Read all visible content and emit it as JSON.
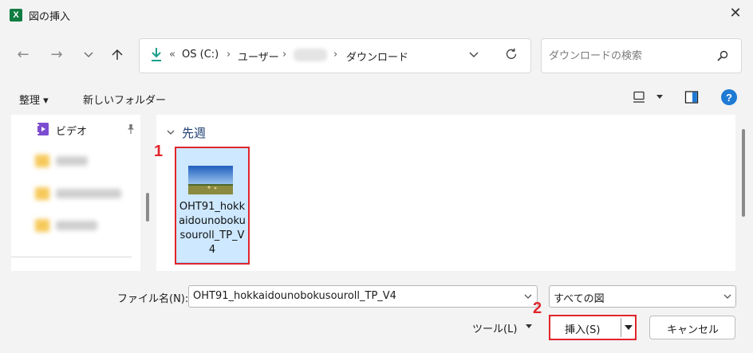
{
  "window": {
    "title": "図の挿入",
    "app_icon_text": "X"
  },
  "address_bar": {
    "overflow_marker": "«",
    "crumbs": [
      "OS (C:)",
      "ユーザー",
      "ダウンロード"
    ]
  },
  "search": {
    "placeholder": "ダウンロードの検索"
  },
  "command_bar": {
    "organize_label": "整理 ▾",
    "new_folder_label": "新しいフォルダー"
  },
  "nav_pane": {
    "video_label": "ビデオ"
  },
  "file_list": {
    "group_label": "先週",
    "files": [
      {
        "name": "OHT91_hokkaidounobokusouroll_TP_V4"
      }
    ]
  },
  "annotations": {
    "step1": "1",
    "step2": "2",
    "color": "#e0262b"
  },
  "bottom": {
    "filename_label": "ファイル名(N):",
    "filename_value": "OHT91_hokkaidounobokusouroll_TP_V4",
    "filetype_value": "すべての図",
    "tools_label": "ツール(L)",
    "insert_label": "挿入(S)",
    "cancel_label": "キャンセル"
  },
  "colors": {
    "accent": "#1f7ad3",
    "selection": "#cde8ff",
    "excel_green": "#107c41"
  }
}
